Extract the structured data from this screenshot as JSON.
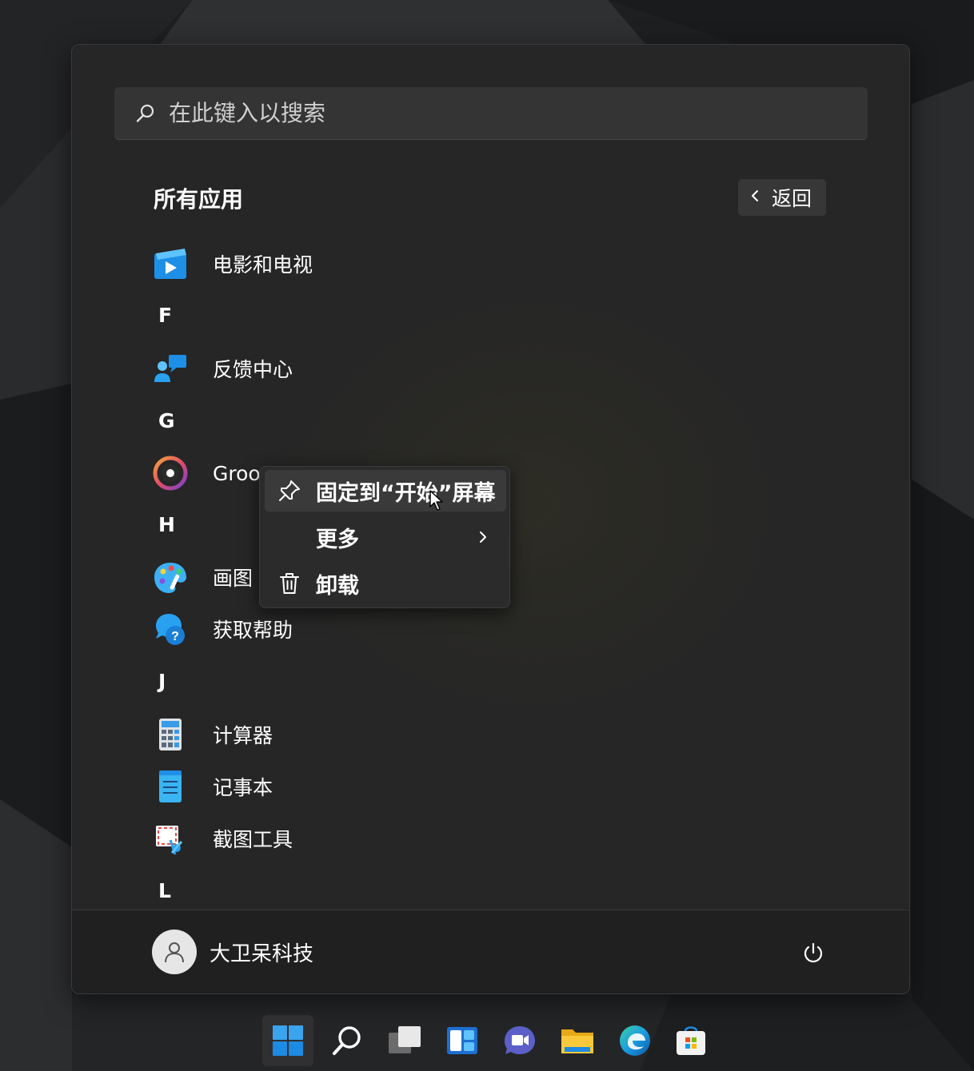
{
  "search": {
    "placeholder": "在此键入以搜索"
  },
  "section": {
    "title": "所有应用",
    "back_label": "返回"
  },
  "apps": {
    "movies_tv": "电影和电视",
    "letter_f": "F",
    "feedback_hub": "反馈中心",
    "letter_g": "G",
    "groove": "Groo",
    "letter_h": "H",
    "paint": "画图",
    "get_help": "获取帮助",
    "letter_j": "J",
    "calculator": "计算器",
    "notepad": "记事本",
    "snipping_tool": "截图工具",
    "letter_l": "L"
  },
  "context_menu": {
    "pin": "固定到“开始”屏幕",
    "more": "更多",
    "uninstall": "卸载"
  },
  "user": {
    "name": "大卫呆科技"
  },
  "colors": {
    "menu_bg": "#262626",
    "footer_bg": "#202020",
    "accent_blue": "#0078d4",
    "context_bg": "#2b2b2b"
  },
  "icons": {
    "search": "search-icon",
    "back": "chevron-left-icon",
    "power": "power-icon",
    "pin": "pin-icon",
    "trash": "trash-icon",
    "more": "chevron-right-icon"
  }
}
